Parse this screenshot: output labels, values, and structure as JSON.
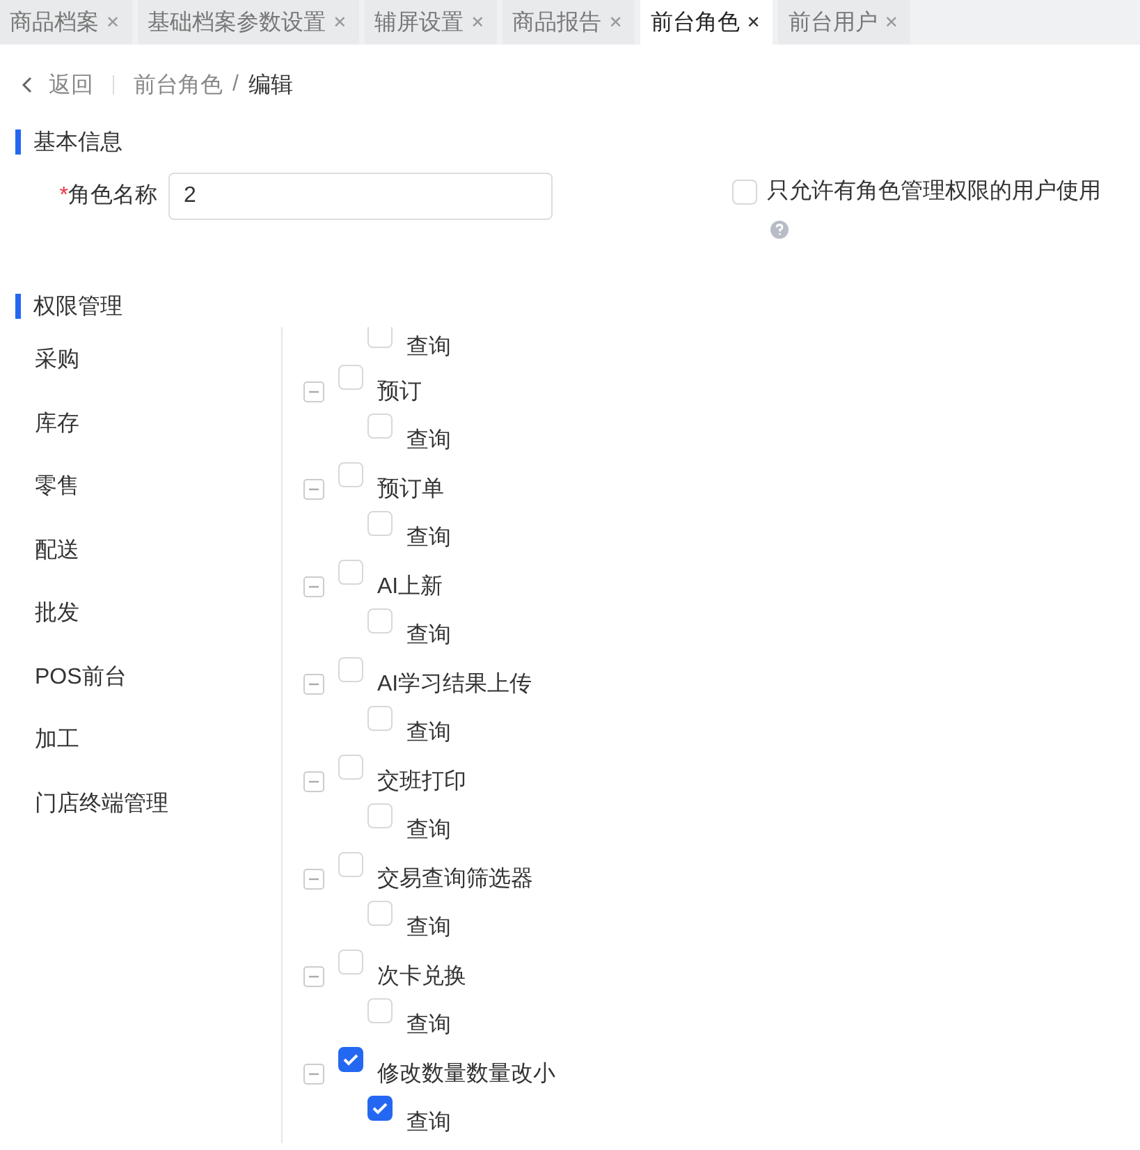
{
  "tabs": [
    {
      "label": "商品档案",
      "selected": false
    },
    {
      "label": "基础档案参数设置",
      "selected": false
    },
    {
      "label": "辅屏设置",
      "selected": false
    },
    {
      "label": "商品报告",
      "selected": false
    },
    {
      "label": "前台角色",
      "selected": true
    },
    {
      "label": "前台用户",
      "selected": false
    }
  ],
  "tab_close": "✕",
  "breadcrumb": {
    "back": "返回",
    "items": [
      "前台角色",
      "编辑"
    ],
    "separator": "/"
  },
  "basic_section": {
    "title": "基本信息"
  },
  "role_name": {
    "label": "角色名称",
    "required_mark": "*",
    "value": "2"
  },
  "restrict": {
    "label": "只允许有角色管理权限的用户使用",
    "checked": false
  },
  "permission_section": {
    "title": "权限管理"
  },
  "menu": [
    {
      "label": "采购"
    },
    {
      "label": "库存"
    },
    {
      "label": "零售"
    },
    {
      "label": "配送"
    },
    {
      "label": "批发"
    },
    {
      "label": "POS前台"
    },
    {
      "label": "加工"
    },
    {
      "label": "门店终端管理"
    }
  ],
  "tree": {
    "leading_children": [
      {
        "label": "查询",
        "checked": false
      }
    ],
    "nodes": [
      {
        "label": "预订",
        "checked": false,
        "expanded": true,
        "children": [
          {
            "label": "查询",
            "checked": false
          }
        ]
      },
      {
        "label": "预订单",
        "checked": false,
        "expanded": true,
        "children": [
          {
            "label": "查询",
            "checked": false
          }
        ]
      },
      {
        "label": "AI上新",
        "checked": false,
        "expanded": true,
        "children": [
          {
            "label": "查询",
            "checked": false
          }
        ]
      },
      {
        "label": "AI学习结果上传",
        "checked": false,
        "expanded": true,
        "children": [
          {
            "label": "查询",
            "checked": false
          }
        ]
      },
      {
        "label": "交班打印",
        "checked": false,
        "expanded": true,
        "children": [
          {
            "label": "查询",
            "checked": false
          }
        ]
      },
      {
        "label": "交易查询筛选器",
        "checked": false,
        "expanded": true,
        "children": [
          {
            "label": "查询",
            "checked": false
          }
        ]
      },
      {
        "label": "次卡兑换",
        "checked": false,
        "expanded": true,
        "children": [
          {
            "label": "查询",
            "checked": false
          }
        ]
      },
      {
        "label": "修改数量数量改小",
        "checked": true,
        "expanded": true,
        "children": [
          {
            "label": "查询",
            "checked": true
          }
        ]
      }
    ]
  }
}
